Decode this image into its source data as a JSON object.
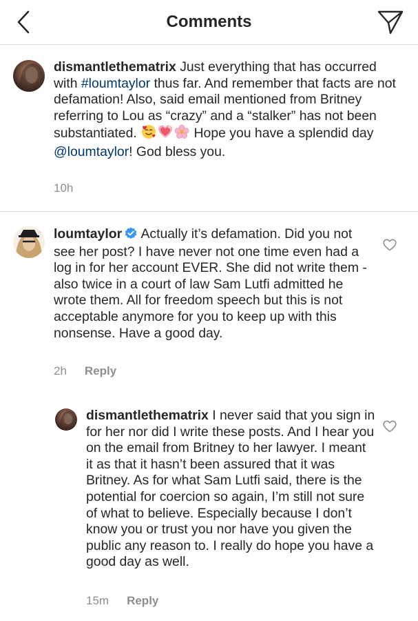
{
  "header": {
    "title": "Comments"
  },
  "caption": {
    "username": "dismantlethematrix",
    "text_part1": "Just everything that has occurred with",
    "hashtag": "#loumtaylor",
    "text_part2": "thus far. And remember that facts are not defamation! Also, said email mentioned from Britney referring to Lou as “crazy” and a “stalker” has not been substantiated.",
    "text_part3": "Hope you have a splendid day",
    "mention": "@loumtaylor",
    "text_part4": "! God bless you.",
    "time": "10h"
  },
  "comments": [
    {
      "username": "loumtaylor",
      "verified": true,
      "text": "Actually it’s defamation. Did you not see her post? I have never not one time even had a log in for her account EVER.  She did not write them - also twice in a court of law Sam Lutfi admitted he wrote them. All for freedom speech but this is not acceptable anymore for you to keep up with this nonsense. Have a good day.",
      "time": "2h",
      "reply_label": "Reply"
    },
    {
      "username": "dismantlethematrix",
      "text": "I never said that you sign in for her nor did I write these posts. And I hear you on the email from Britney to her lawyer. I meant it as that it hasn’t been assured that it was Britney. As for what Sam Lutfi said, there is the potential for coercion so again, I’m still not sure of what to believe. Especially because I don’t know you or trust you nor have you given the public any reason to. I really do hope you have a good day as well.",
      "time": "15m",
      "reply_label": "Reply"
    }
  ],
  "colors": {
    "text": "#262626",
    "meta": "#8e8e8e",
    "link": "#00376b",
    "verified": "#3897f0",
    "divider": "#dbdbdb"
  },
  "icons": {
    "back": "chevron-left-icon",
    "share": "paper-plane-icon",
    "like": "heart-outline-icon",
    "verified": "verified-badge-icon"
  }
}
